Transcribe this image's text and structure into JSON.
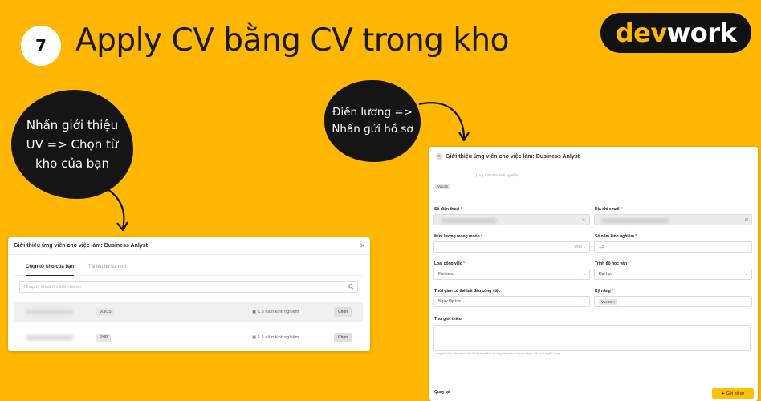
{
  "slide": {
    "step_number": "7",
    "title": "Apply CV bằng CV trong kho",
    "logo_part1": "dev",
    "logo_part2": "work",
    "bubble_left": "Nhấn giới thiệu UV => Chọn từ kho của bạn",
    "bubble_right": "Điền lương => Nhấn gửi hồ sơ"
  },
  "colors": {
    "background": "#FFB703",
    "bubble": "#151515",
    "logo_accent": "#FFB703",
    "submit": "#FFC107"
  },
  "modal_left": {
    "title": "Giới thiệu ứng viên cho việc làm: Business Anlyst",
    "tab_active": "Chọn từ kho của bạn",
    "tab_other": "Tải lên hồ sơ mới",
    "search_placeholder": "Nhập từ khoá tìm kiếm hồ sơ",
    "rows": [
      {
        "tag": "VueJS",
        "experience": "1.5 năm kinh nghiệm",
        "action": "Chọn"
      },
      {
        "tag": "PHP",
        "experience": "1.5 năm kinh nghiệm",
        "action": "Chọn"
      }
    ]
  },
  "modal_right": {
    "title": "Giới thiệu ứng viên cho việc làm: Business Anlyst",
    "meta": "|  ☁  |  1.5 năm kinh nghiệm",
    "tag": "VueJS",
    "phone_label": "Số điện thoại",
    "phone_suffix": "☏",
    "email_label": "Địa chỉ email",
    "salary_label": "Mức lương mong muốn",
    "salary_currency": "VNĐ ⌄",
    "years_label": "Số năm kinh nghiệm",
    "years_value": "1,5",
    "jobtype_label": "Loại công việc",
    "jobtype_value": "Frontend",
    "education_label": "Trình độ học vấn",
    "education_value": "Đại học",
    "start_label": "Thời gian có thể bắt đầu công việc",
    "start_value": "Ngay lập tức",
    "skills_label": "Kỹ năng",
    "skills_chip": "VueJS ×",
    "intro_label": "Thư giới thiệu",
    "intro_helper": "Lời giới thiệu, ghi chú hoặc thông tin thêm về ứng viên bạn thấy phù hợp với vị trí tuyển dụng...",
    "return_label": "Quay lại",
    "submit_label": "Gửi hồ sơ"
  }
}
